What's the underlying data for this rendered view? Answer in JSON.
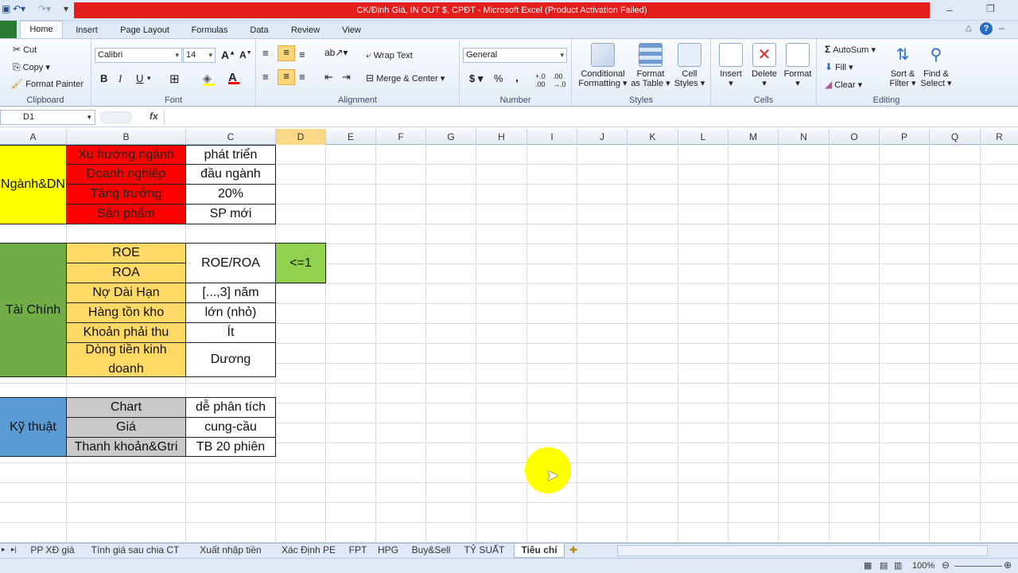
{
  "window": {
    "title": "CK/Định Giá, IN OUT $, CPĐT -  Microsoft Excel (Product Activation Failed)"
  },
  "ribbon_tabs": [
    "Home",
    "Insert",
    "Page Layout",
    "Formulas",
    "Data",
    "Review",
    "View"
  ],
  "clipboard": {
    "cut": "Cut",
    "copy": "Copy",
    "format_painter": "Format Painter",
    "label": "Clipboard"
  },
  "font": {
    "name": "Calibri",
    "size": "14",
    "label": "Font",
    "bold": "B",
    "italic": "I",
    "underline": "U"
  },
  "alignment": {
    "wrap_text": "Wrap Text",
    "merge_center": "Merge & Center",
    "label": "Alignment"
  },
  "number": {
    "format": "General",
    "label": "Number",
    "currency": "$",
    "percent": "%",
    "comma": ","
  },
  "styles": {
    "conditional": [
      "Conditional",
      "Formatting"
    ],
    "format_table": [
      "Format",
      "as Table"
    ],
    "cell_styles": [
      "Cell",
      "Styles"
    ],
    "label": "Styles"
  },
  "cells": {
    "insert": "Insert",
    "delete": "Delete",
    "format": "Format",
    "label": "Cells"
  },
  "editing": {
    "autosum": "AutoSum",
    "fill": "Fill",
    "clear": "Clear",
    "sort": [
      "Sort &",
      "Filter"
    ],
    "find": [
      "Find &",
      "Select"
    ],
    "label": "Editing"
  },
  "formula_bar": {
    "name_box": "D1",
    "fx": "fx",
    "formula": ""
  },
  "columns": [
    "A",
    "B",
    "C",
    "D",
    "E",
    "F",
    "G",
    "H",
    "I",
    "J",
    "K",
    "L",
    "M",
    "N",
    "O",
    "P",
    "Q",
    "R"
  ],
  "cells_data": {
    "a1": "Ngành&DN",
    "b1": "Xu hướng ngành",
    "c1": "phát triển",
    "b2": "Doanh nghiệp",
    "c2": "đầu ngành",
    "b3": "Tăng trưởng",
    "c3": "20%",
    "b4": "Sản phẩm",
    "c4": "SP mới",
    "a6": "Tài Chính",
    "b6": "ROE",
    "b7": "ROA",
    "c6": "ROE/ROA",
    "d6": "<=1",
    "b8": "Nợ Dài Hạn",
    "c8": "[...,3] năm",
    "b9": "Hàng tồn kho",
    "c9": "lớn (nhỏ)",
    "b10": "Khoản phải thu",
    "c10": "Ít",
    "b11": "Dòng tiền kinh doanh",
    "c11": "Dương",
    "a13": "Kỹ thuật",
    "b13": "Chart",
    "c13": "dễ phân tích",
    "b14": "Giá",
    "c14": "cung-cầu",
    "b15": "Thanh khoản&Gtri",
    "c15": "TB 20 phiên"
  },
  "sheet_tabs": [
    "PP XĐ giá",
    "Tính giá sau chia CT",
    "Xuất nhập tiền",
    "Xác Định PE",
    "FPT",
    "HPG",
    "Buy&Sell",
    "TỶ SUẤT",
    "Tiêu chí"
  ],
  "active_sheet": "Tiêu chí",
  "status": {
    "zoom": "100%"
  },
  "colors": {
    "red": "#ff0000",
    "yellow": "#ffff00",
    "green": "#70ad47",
    "orange": "#ffd966",
    "light_green": "#92d050",
    "blue": "#5b9bd5",
    "gray": "#c9c9c9"
  }
}
